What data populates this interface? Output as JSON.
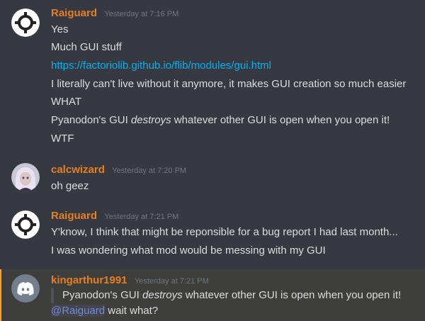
{
  "colors": {
    "background": "#36393f",
    "username": "#e67e22",
    "timestamp": "#72767d",
    "text": "#dcddde",
    "link": "#00b0f4",
    "mention": "#7289da",
    "highlight_bar": "#faa61a"
  },
  "messages": [
    {
      "author": "Raiguard",
      "timestamp": "Yesterday at 7:16 PM",
      "avatar_icon": "factorio-gear-avatar",
      "lines": [
        "Yes",
        "Much GUI stuff",
        "https://factoriolib.github.io/flib/modules/gui.html",
        "I literally can't live without it anymore, it makes GUI creation so much easier",
        "WHAT",
        {
          "before": "Pyanodon's GUI ",
          "emphasis": "destroys",
          "after": " whatever other GUI is open when you open it!"
        },
        "WTF"
      ]
    },
    {
      "author": "calcwizard",
      "timestamp": "Yesterday at 7:20 PM",
      "avatar_icon": "anime-portrait-avatar",
      "lines": [
        "oh geez"
      ]
    },
    {
      "author": "Raiguard",
      "timestamp": "Yesterday at 7:21 PM",
      "avatar_icon": "factorio-gear-avatar",
      "lines": [
        "Y'know, I think that might be reponsible for a bug report I had last month...",
        "I was wondering what mod would be messing with my GUI"
      ]
    },
    {
      "author": "kingarthur1991",
      "timestamp": "Yesterday at 7:21 PM",
      "avatar_icon": "discord-logo-avatar",
      "quote": {
        "before": "Pyanodon's GUI ",
        "emphasis": "destroys",
        "after": " whatever other GUI is open when you open it!"
      },
      "mention": "@Raiguard",
      "reply": " wait what?"
    }
  ]
}
